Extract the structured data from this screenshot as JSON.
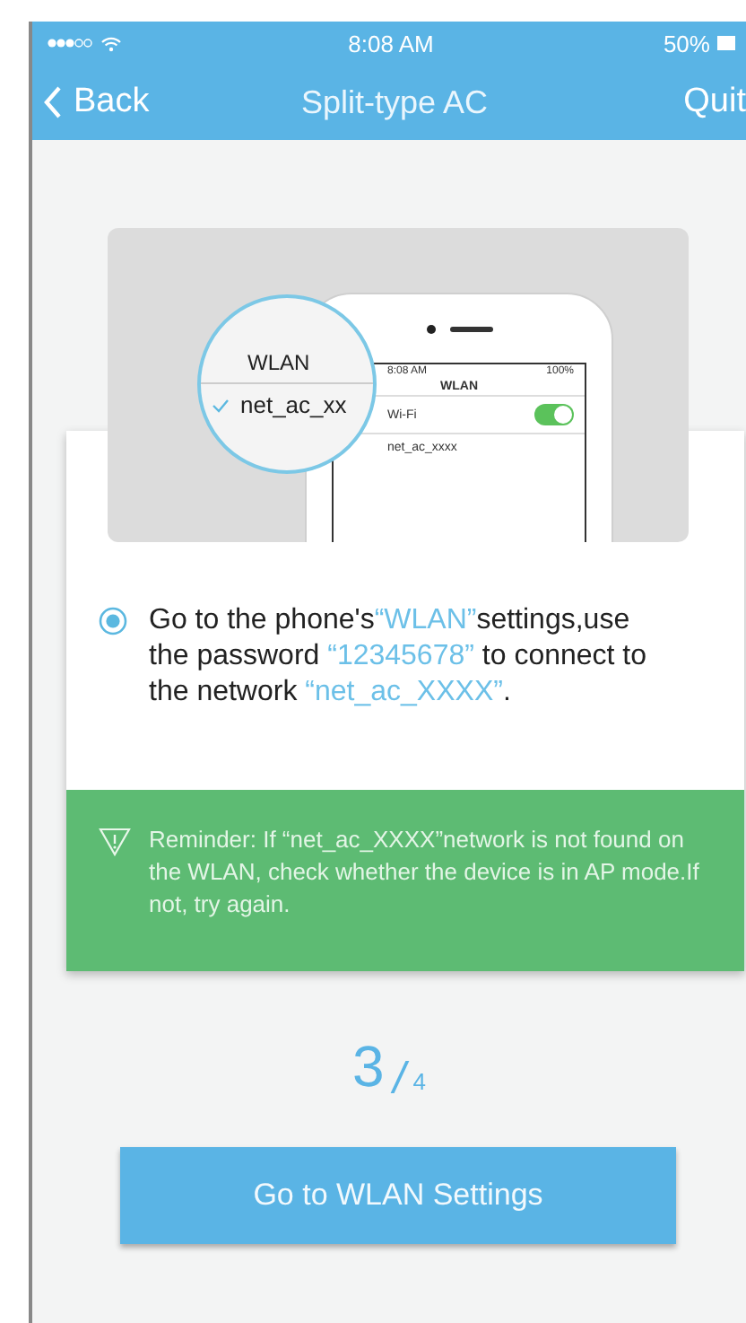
{
  "status_bar": {
    "time": "8:08 AM",
    "battery": "50%"
  },
  "nav": {
    "back": "Back",
    "title": "Split-type AC",
    "quit": "Quit"
  },
  "illustration": {
    "magnifier_title": "WLAN",
    "magnifier_network": "net_ac_xx",
    "phone_time": "8:08 AM",
    "phone_battery": "100%",
    "phone_title": "WLAN",
    "wifi_label": "Wi-Fi",
    "wifi_on": true,
    "network": "net_ac_xxxx"
  },
  "instruction": {
    "segments": [
      {
        "text": "Go to the phone's",
        "highlight": false
      },
      {
        "text": "“WLAN”",
        "highlight": true
      },
      {
        "text": "settings,use the password ",
        "highlight": false
      },
      {
        "text": "“12345678”",
        "highlight": true
      },
      {
        "text": " to connect to the network ",
        "highlight": false
      },
      {
        "text": "“net_ac_XXXX”",
        "highlight": true
      },
      {
        "text": ".",
        "highlight": false
      }
    ]
  },
  "reminder": "Reminder: If “net_ac_XXXX”network is not found on the WLAN, check whether the device is in AP mode.If not, try again.",
  "step": {
    "current": "3",
    "total": "4"
  },
  "button": "Go to WLAN Settings"
}
